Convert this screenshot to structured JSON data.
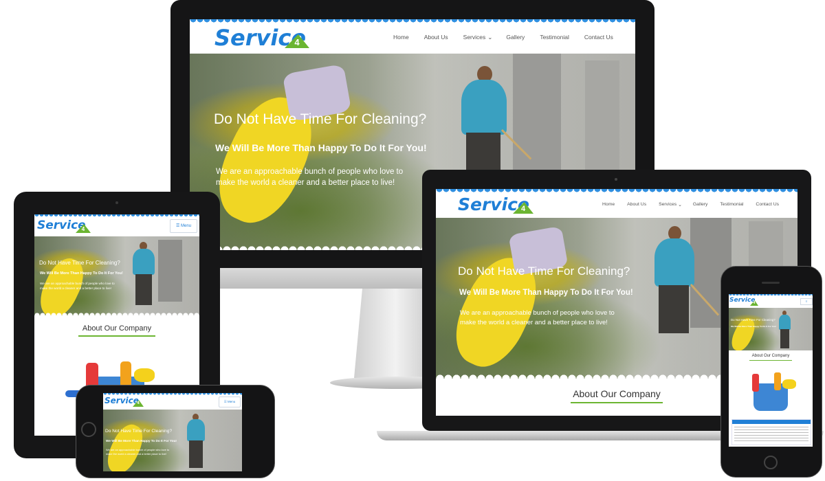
{
  "site": {
    "logo_text": "Service",
    "logo_badge": "4",
    "nav": [
      "Home",
      "About Us",
      "Services",
      "Gallery",
      "Testimonial",
      "Contact Us"
    ],
    "services_caret": "⌄",
    "menu_label": "Menu",
    "hero_title": "Do Not Have Time For Cleaning?",
    "hero_subtitle": "We Will Be More Than Happy To Do It For You!",
    "hero_text_line1": "We are an approachable bunch of people who love to",
    "hero_text_line2": "make the world a cleaner and a better place to live!",
    "about_title": "About Our Company"
  },
  "colors": {
    "brand_blue": "#1f7fd6",
    "accent_green": "#6bb531",
    "device_black": "#1d1d1f"
  }
}
